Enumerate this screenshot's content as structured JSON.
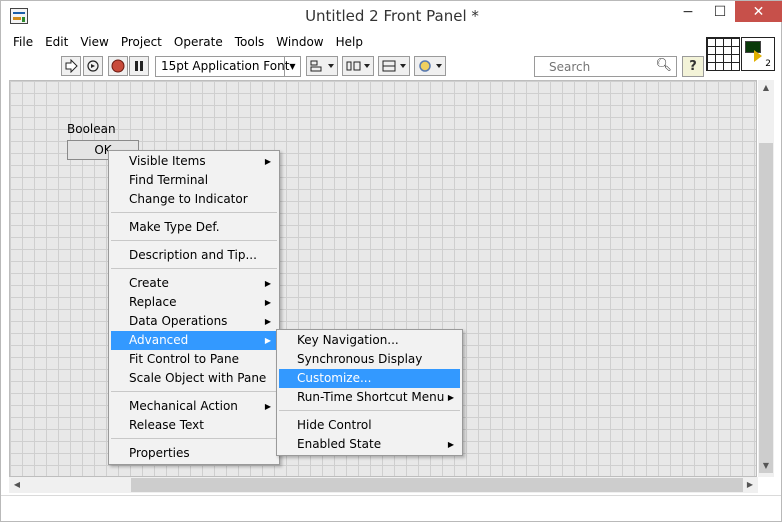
{
  "window": {
    "title": "Untitled 2 Front Panel *",
    "minimize_label": "−",
    "maximize_label": "☐",
    "close_label": "✕"
  },
  "menubar": {
    "items": [
      "File",
      "Edit",
      "View",
      "Project",
      "Operate",
      "Tools",
      "Window",
      "Help"
    ]
  },
  "toolbar": {
    "run_icon": "run-arrow-icon",
    "run_continuous_icon": "run-continuously-icon",
    "abort_icon": "abort-icon",
    "pause_icon": "pause-icon",
    "font_label": "15pt Application Font",
    "align_icon": "align-objects-icon",
    "distribute_icon": "distribute-objects-icon",
    "resize_icon": "resize-objects-icon",
    "reorder_icon": "reorder-icon",
    "search_placeholder": "Search",
    "help_label": "?",
    "vi_icon_number": "2"
  },
  "panel": {
    "boolean_label": "Boolean",
    "boolean_button_text": "OK"
  },
  "context_menu": {
    "items": [
      {
        "label": "Visible Items",
        "submenu": true
      },
      {
        "label": "Find Terminal"
      },
      {
        "label": "Change to Indicator"
      },
      {
        "label": "Make Type Def."
      },
      {
        "label": "Description and Tip..."
      },
      {
        "label": "Create",
        "submenu": true
      },
      {
        "label": "Replace",
        "submenu": true
      },
      {
        "label": "Data Operations",
        "submenu": true
      },
      {
        "label": "Advanced",
        "submenu": true,
        "active": true
      },
      {
        "label": "Fit Control to Pane"
      },
      {
        "label": "Scale Object with Pane"
      },
      {
        "label": "Mechanical Action",
        "submenu": true
      },
      {
        "label": "Release Text"
      },
      {
        "label": "Properties"
      }
    ]
  },
  "submenu": {
    "items": [
      {
        "label": "Key Navigation..."
      },
      {
        "label": "Synchronous Display"
      },
      {
        "label": "Customize...",
        "active": true
      },
      {
        "label": "Run-Time Shortcut Menu",
        "submenu": true
      },
      {
        "label": "Hide Control"
      },
      {
        "label": "Enabled State",
        "submenu": true
      }
    ]
  },
  "colors": {
    "highlight": "#3399ff",
    "grid_bg": "#e8e8e8",
    "close_button": "#c7504a"
  }
}
